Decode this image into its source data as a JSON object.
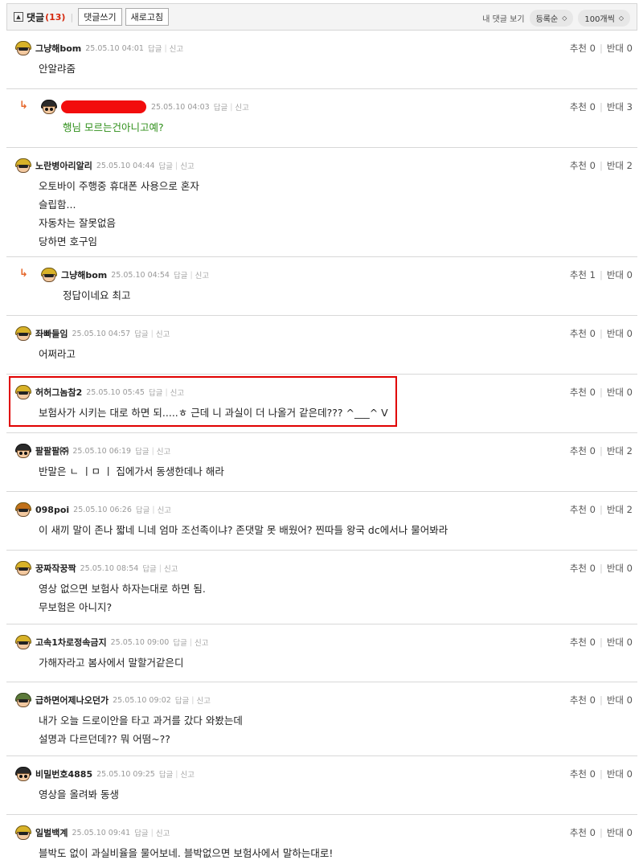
{
  "header": {
    "title": "댓글",
    "count": "(13)",
    "write_label": "댓글쓰기",
    "refresh_label": "새로고침",
    "my_comments_label": "내 댓글 보기",
    "sort_label": "등록순",
    "per_page_label": "100개씩"
  },
  "actions": {
    "reply": "답글",
    "report": "신고",
    "up": "추천",
    "down": "반대"
  },
  "comments": [
    {
      "nick": "그냥해bom",
      "date": "25.05.10 04:01",
      "up": "0",
      "down": "0",
      "lines": [
        "안알랴줌"
      ]
    },
    {
      "nick": "",
      "date": "25.05.10 04:03",
      "up": "0",
      "down": "3",
      "lines": [
        "행님 모르는건아니고예?"
      ]
    },
    {
      "nick": "노란병아리알리",
      "date": "25.05.10 04:44",
      "up": "0",
      "down": "2",
      "lines": [
        "오토바이 주행중 휴대폰 사용으로 혼자",
        "슬립함...",
        "자동차는 잘못없음",
        "당하면 호구임"
      ]
    },
    {
      "nick": "그냥해bom",
      "date": "25.05.10 04:54",
      "up": "1",
      "down": "0",
      "lines": [
        "정답이네요 최고"
      ]
    },
    {
      "nick": "좌빠들임",
      "date": "25.05.10 04:57",
      "up": "0",
      "down": "0",
      "lines": [
        "어쩌라고"
      ]
    },
    {
      "nick": "허허그놈참2",
      "date": "25.05.10 05:45",
      "up": "0",
      "down": "0",
      "lines": [
        "보험사가 시키는 대로 하면 되.....ㅎ 근데 니 과실이 더 나올거 같은데??? ^___^ V"
      ]
    },
    {
      "nick": "팔팔팔㈜",
      "date": "25.05.10 06:19",
      "up": "0",
      "down": "2",
      "lines": [
        "반말은 ㄴ ㅣㅁ ㅣ 집에가서 동생한데나 해라"
      ]
    },
    {
      "nick": "098poi",
      "date": "25.05.10 06:26",
      "up": "0",
      "down": "2",
      "lines": [
        "이 새끼 말이 존나 짧네 니네 엄마 조선족이냐? 존댓말 못 배웠어? 찐따들 왕국 dc에서나 물어봐라"
      ]
    },
    {
      "nick": "꿍짜작꿍짝",
      "date": "25.05.10 08:54",
      "up": "0",
      "down": "0",
      "lines": [
        "영상 없으면 보험사 하자는대로 하면 됨.",
        "무보험은 아니지?"
      ]
    },
    {
      "nick": "고속1차로정속금지",
      "date": "25.05.10 09:00",
      "up": "0",
      "down": "0",
      "lines": [
        "가해자라고 봄사에서 말할거같은디"
      ]
    },
    {
      "nick": "급하면어제나오던가",
      "date": "25.05.10 09:02",
      "up": "0",
      "down": "0",
      "lines": [
        "내가 오늘 드로이안을 타고 과거를 갔다 와봤는데",
        "설명과 다르던데?? 뭐 어떰~??"
      ]
    },
    {
      "nick": "비밀번호4885",
      "date": "25.05.10 09:25",
      "up": "0",
      "down": "0",
      "lines": [
        "영상을 올려봐 동생"
      ]
    },
    {
      "nick": "일벌백계",
      "date": "25.05.10 09:41",
      "up": "0",
      "down": "0",
      "lines": [
        "블박도 없이 과실비율을 물어보네. 블박없으면 보험사에서 말하는대로!"
      ]
    }
  ]
}
